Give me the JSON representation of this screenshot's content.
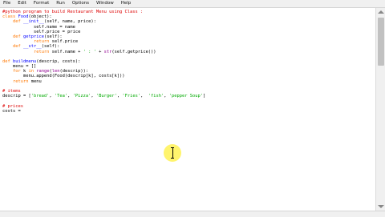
{
  "menubar": {
    "items": [
      "File",
      "Edit",
      "Format",
      "Run",
      "Options",
      "Window",
      "Help"
    ]
  },
  "editor": {
    "lines": [
      [
        {
          "t": "#python program to build Restaurant Menu using Class :",
          "c": "cm"
        }
      ],
      [
        {
          "t": "class",
          "c": "kw"
        },
        {
          "t": " ",
          "c": "pl"
        },
        {
          "t": "Food",
          "c": "fn"
        },
        {
          "t": "(object):",
          "c": "pl"
        }
      ],
      [
        {
          "t": "    ",
          "c": "pl"
        },
        {
          "t": "def",
          "c": "kw"
        },
        {
          "t": " ",
          "c": "pl"
        },
        {
          "t": "__init__",
          "c": "fn"
        },
        {
          "t": "(self, name, price):",
          "c": "pl"
        }
      ],
      [
        {
          "t": "            self.name = name",
          "c": "pl"
        }
      ],
      [
        {
          "t": "            self.price = price",
          "c": "pl"
        }
      ],
      [
        {
          "t": "    ",
          "c": "pl"
        },
        {
          "t": "def",
          "c": "kw"
        },
        {
          "t": " ",
          "c": "pl"
        },
        {
          "t": "getprice",
          "c": "fn"
        },
        {
          "t": "(self):",
          "c": "pl"
        }
      ],
      [
        {
          "t": "            ",
          "c": "pl"
        },
        {
          "t": "return",
          "c": "kw"
        },
        {
          "t": " self.price",
          "c": "pl"
        }
      ],
      [
        {
          "t": "    ",
          "c": "pl"
        },
        {
          "t": "def",
          "c": "kw"
        },
        {
          "t": " ",
          "c": "pl"
        },
        {
          "t": "__str__",
          "c": "fn"
        },
        {
          "t": "(self):",
          "c": "pl"
        }
      ],
      [
        {
          "t": "            ",
          "c": "pl"
        },
        {
          "t": "return",
          "c": "kw"
        },
        {
          "t": " self.name + ",
          "c": "pl"
        },
        {
          "t": "' : '",
          "c": "st"
        },
        {
          "t": " + ",
          "c": "pl"
        },
        {
          "t": "str",
          "c": "bi"
        },
        {
          "t": "(self.getprice())",
          "c": "pl"
        }
      ],
      [
        {
          "t": "",
          "c": "pl"
        }
      ],
      [
        {
          "t": "def",
          "c": "kw"
        },
        {
          "t": " ",
          "c": "pl"
        },
        {
          "t": "buildmenu",
          "c": "fn"
        },
        {
          "t": "(descrip, costs):",
          "c": "pl"
        }
      ],
      [
        {
          "t": "    menu = []",
          "c": "pl"
        }
      ],
      [
        {
          "t": "    ",
          "c": "pl"
        },
        {
          "t": "for",
          "c": "kw"
        },
        {
          "t": " k ",
          "c": "pl"
        },
        {
          "t": "in",
          "c": "kw"
        },
        {
          "t": " ",
          "c": "pl"
        },
        {
          "t": "range",
          "c": "bi"
        },
        {
          "t": "(",
          "c": "pl"
        },
        {
          "t": "len",
          "c": "bi"
        },
        {
          "t": "(descrip)):",
          "c": "pl"
        }
      ],
      [
        {
          "t": "        menu.append(Food(descrip[k], costs[k]))",
          "c": "pl"
        }
      ],
      [
        {
          "t": "    ",
          "c": "pl"
        },
        {
          "t": "return",
          "c": "kw"
        },
        {
          "t": " menu",
          "c": "pl"
        }
      ],
      [
        {
          "t": "",
          "c": "pl"
        }
      ],
      [
        {
          "t": "# items",
          "c": "cm"
        }
      ],
      [
        {
          "t": "descrip = [",
          "c": "pl"
        },
        {
          "t": "'bread'",
          "c": "st"
        },
        {
          "t": ", ",
          "c": "pl"
        },
        {
          "t": "'Tea'",
          "c": "st"
        },
        {
          "t": ", ",
          "c": "pl"
        },
        {
          "t": "'Pizza'",
          "c": "st"
        },
        {
          "t": ", ",
          "c": "pl"
        },
        {
          "t": "'Burger'",
          "c": "st"
        },
        {
          "t": ", ",
          "c": "pl"
        },
        {
          "t": "'Fries'",
          "c": "st"
        },
        {
          "t": ",  ",
          "c": "pl"
        },
        {
          "t": "'fish'",
          "c": "st"
        },
        {
          "t": ", ",
          "c": "pl"
        },
        {
          "t": "'pepper Soup'",
          "c": "st"
        },
        {
          "t": "]",
          "c": "pl"
        }
      ],
      [
        {
          "t": "",
          "c": "pl"
        }
      ],
      [
        {
          "t": "# prices",
          "c": "cm"
        }
      ],
      [
        {
          "t": "costs = ",
          "c": "pl"
        }
      ]
    ]
  },
  "colors": {
    "keyword": "#ff7700",
    "comment": "#dd0000",
    "string": "#00aa00",
    "definition": "#0000ff",
    "builtin": "#900090",
    "click_highlight": "#fff03c"
  },
  "icons": {
    "cursor": "text-cursor-icon",
    "scroll_up": "arrow-up-icon",
    "scroll_down": "arrow-down-icon"
  }
}
